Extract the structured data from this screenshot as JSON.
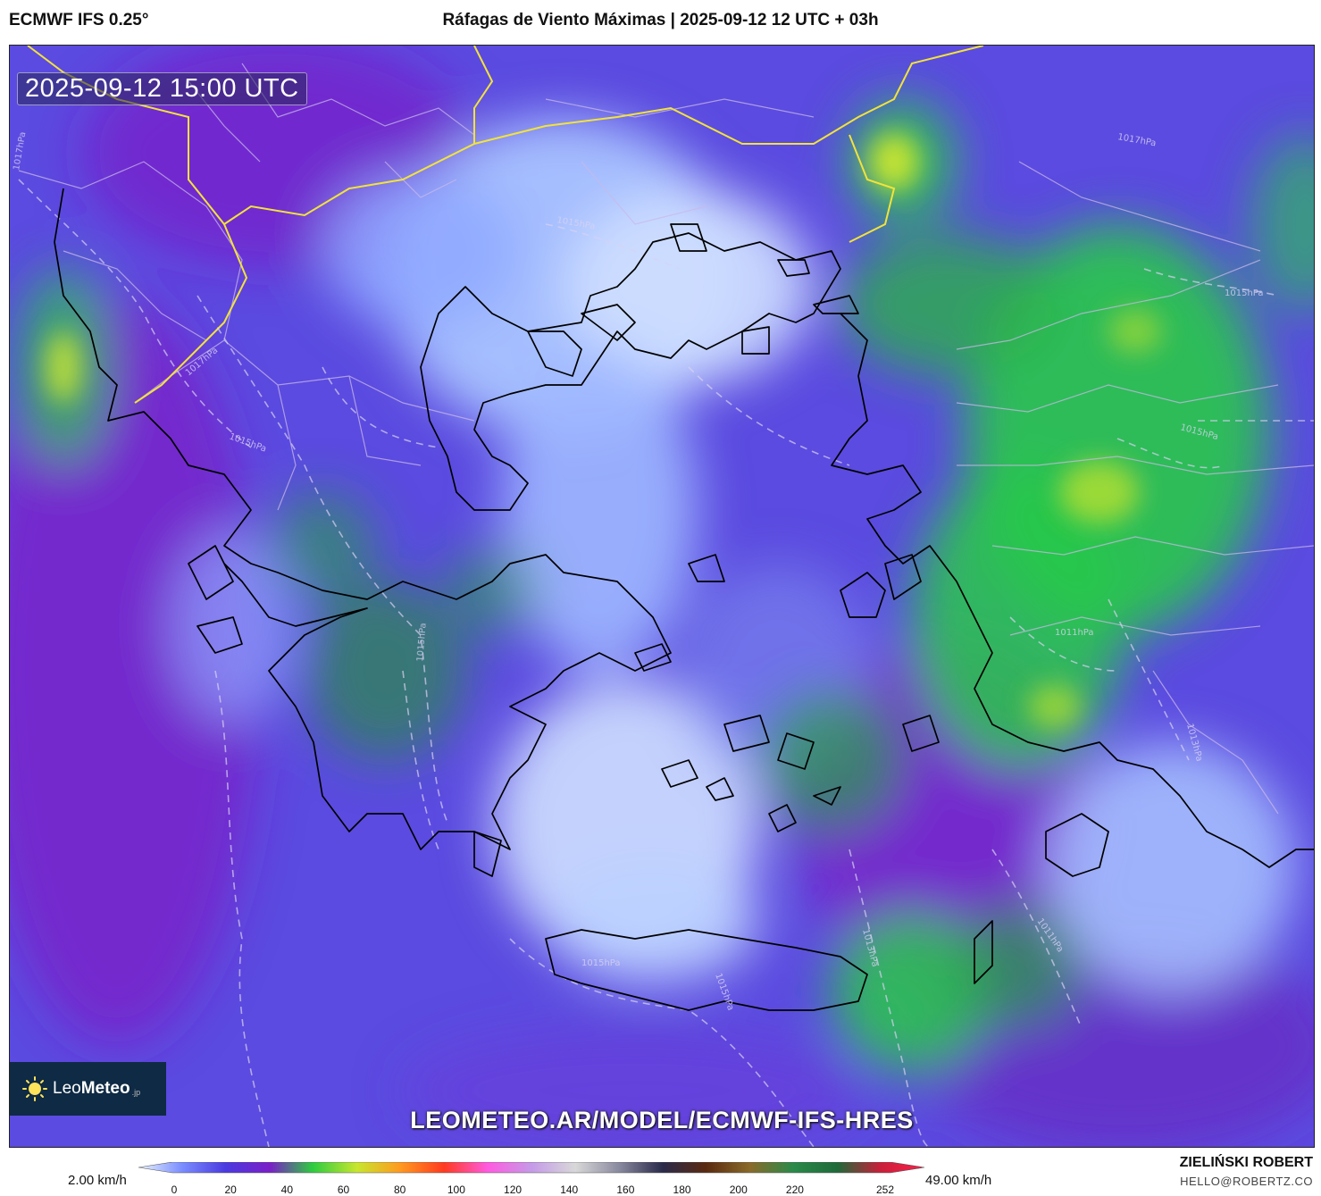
{
  "header": {
    "model": "ECMWF IFS 0.25°",
    "title": "Ráfagas de Viento Máximas | 2025-09-12 12 UTC + 03h"
  },
  "map": {
    "valid_time": "2025-09-12 15:00 UTC",
    "isobar_labels": [
      "1017hPa",
      "1017hPa",
      "1015hPa",
      "1015hPa",
      "1015hPa",
      "1015hPa",
      "1015hPa",
      "1013hPa",
      "1013hPa",
      "1011hPa",
      "1011hPa",
      "1017hPa",
      "1015hPa",
      "1015hPa"
    ],
    "watermark": "LEOMETEO.AR/MODEL/ECMWF-IFS-HRES",
    "logo": {
      "brand_light": "Leo",
      "brand_bold": "Meteo",
      "suffix": ".jp"
    }
  },
  "legend": {
    "min_label": "2.00 km/h",
    "max_label": "49.00 km/h",
    "ticks": [
      "0",
      "20",
      "40",
      "60",
      "80",
      "100",
      "120",
      "140",
      "160",
      "180",
      "200",
      "220",
      "252"
    ],
    "stops": [
      "#e8f4ff",
      "#7a8cff",
      "#4a3ae0",
      "#7a1fc8",
      "#2ecc40",
      "#c8e62e",
      "#ff9a1f",
      "#ff3a1f",
      "#ff5ae0",
      "#c59ae8",
      "#d8d8d8",
      "#8a8aa0",
      "#2a2a4a",
      "#5a2a10",
      "#8a6a2a",
      "#2a8a4a",
      "#1f6a3a",
      "#c81f3a",
      "#ff1f4a"
    ],
    "colors": {
      "calm": "#cfe0ff",
      "light": "#8fa8ff",
      "moderate": "#5b4be0",
      "fresh": "#7a1fc8",
      "strong": "#28c94a",
      "gusty": "#d4e82e"
    }
  },
  "credits": {
    "author": "ZIELIŃSKI ROBERT",
    "email": "HELLO@ROBERTZ.CO"
  }
}
